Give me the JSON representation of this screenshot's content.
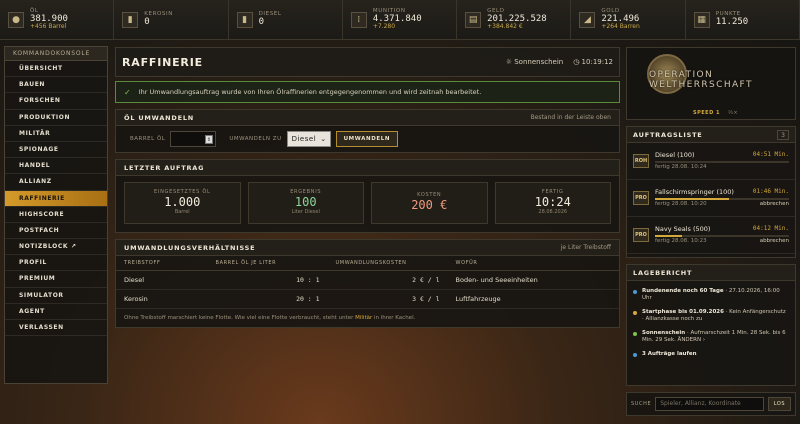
{
  "resources": [
    {
      "label": "Öl",
      "value": "381.900",
      "sub": "+456 Barrel",
      "icon": "oil-drop-icon",
      "glyph": "●"
    },
    {
      "label": "Kerosin",
      "value": "0",
      "sub": "",
      "icon": "kerosene-icon",
      "glyph": "▮"
    },
    {
      "label": "Diesel",
      "value": "0",
      "sub": "",
      "icon": "diesel-icon",
      "glyph": "▮"
    },
    {
      "label": "Munition",
      "value": "4.371.840",
      "sub": "+7.280",
      "icon": "ammo-icon",
      "glyph": "⁞"
    },
    {
      "label": "Geld",
      "value": "201.225.528",
      "sub": "+384.842 €",
      "icon": "money-icon",
      "glyph": "▤"
    },
    {
      "label": "Gold",
      "value": "221.496",
      "sub": "+264 Barren",
      "icon": "gold-icon",
      "glyph": "◢"
    },
    {
      "label": "Punkte",
      "value": "11.250",
      "sub": "",
      "icon": "points-icon",
      "glyph": "▦"
    }
  ],
  "sidebar": {
    "header": "Kommandokonsole",
    "items": [
      "Übersicht",
      "Bauen",
      "Forschen",
      "Produktion",
      "Militär",
      "Spionage",
      "Handel",
      "Allianz",
      "Raffinerie",
      "Highscore",
      "Postfach",
      "Notizblock ↗",
      "Profil",
      "Premium",
      "Simulator",
      "Agent",
      "Verlassen"
    ],
    "active": "Raffinerie"
  },
  "page": {
    "title": "RAFFINERIE",
    "weather": "Sonnenschein",
    "time": "10:19:12"
  },
  "success_message": "Ihr Umwandlungsauftrag wurde von Ihren Ölraffinerien entgegengenommen und wird zeitnah bearbeitet.",
  "convert": {
    "title": "ÖL UMWANDELN",
    "hint": "Bestand in der Leiste oben",
    "barrel_label": "BARREL ÖL",
    "to_label": "UMWANDELN ZU",
    "selected": "Diesel",
    "button": "UMWANDELN"
  },
  "last_order": {
    "title": "LETZTER AUFTRAG",
    "cards": [
      {
        "label": "EINGESETZTES ÖL",
        "value": "1.000",
        "sub": "Barrel"
      },
      {
        "label": "ERGEBNIS",
        "value": "100",
        "sub": "Liter Diesel"
      },
      {
        "label": "KOSTEN",
        "value": "200 €",
        "sub": ""
      },
      {
        "label": "FERTIG",
        "value": "10:24",
        "sub": "28.08.2026"
      }
    ]
  },
  "ratios": {
    "title": "UMWANDLUNGSVERHÄLTNISSE",
    "hint": "je Liter Treibstoff",
    "headers": [
      "TREIBSTOFF",
      "BARREL ÖL JE LITER",
      "UMWANDLUNGSKOSTEN",
      "WOFÜR"
    ],
    "rows": [
      [
        "Diesel",
        "10 : 1",
        "2 € / l",
        "Boden- und Seeeinheiten"
      ],
      [
        "Kerosin",
        "20 : 1",
        "3 € / l",
        "Luftfahrzeuge"
      ]
    ],
    "footnote_pre": "Ohne Treibstoff marschiert keine Flotte. Wie viel eine Flotte verbraucht, steht unter ",
    "footnote_link": "Militär",
    "footnote_post": " in ihrer Kachel."
  },
  "logo": {
    "text_a": "OPERATION",
    "text_b": "WELTHERRSCHAFT",
    "speed": "SPEED 1",
    "speed_extra": "⅓×"
  },
  "orders": {
    "title": "AUFTRAGSLISTE",
    "count": "3",
    "items": [
      {
        "tag": "ROH",
        "name": "Diesel (100)",
        "time": "04:51 Min.",
        "sub": "fertig 28.08. 10:24",
        "action": "",
        "progress": 0
      },
      {
        "tag": "PRO",
        "name": "Fallschirmspringer (100)",
        "time": "01:46 Min.",
        "sub": "fertig 28.08. 10:20",
        "action": "abbrechen",
        "progress": 0.55
      },
      {
        "tag": "PRO",
        "name": "Navy Seals (500)",
        "time": "04:12 Min.",
        "sub": "fertig 28.08. 10:23",
        "action": "abbrechen",
        "progress": 0.2
      }
    ]
  },
  "report": {
    "title": "LAGEBERICHT",
    "items": [
      {
        "color": "#4a9ad4",
        "bold": "Rundenende noch 60 Tage",
        "text": " · 27.10.2026, 16:00 Uhr"
      },
      {
        "color": "#d4a83a",
        "bold": "Startphase bis 01.09.2026",
        "text": " · Kein Anfängerschutz · Allianzkasse noch zu"
      },
      {
        "color": "#7fc24a",
        "bold": "Sonnenschein",
        "text": " · Aufmarschzeit 1 Min. 28 Sek. bis 6 Min. 29 Sek. ÄNDERN ›"
      },
      {
        "color": "#4a9ad4",
        "bold": "3 Aufträge laufen",
        "text": ""
      }
    ]
  },
  "search": {
    "label": "SUCHE",
    "placeholder": "Spieler, Allianz, Koordinate",
    "button": "LOS"
  },
  "colors": {
    "accent": "#d4a83a",
    "success": "#7fc24a",
    "active_nav": "#d49a2a"
  }
}
